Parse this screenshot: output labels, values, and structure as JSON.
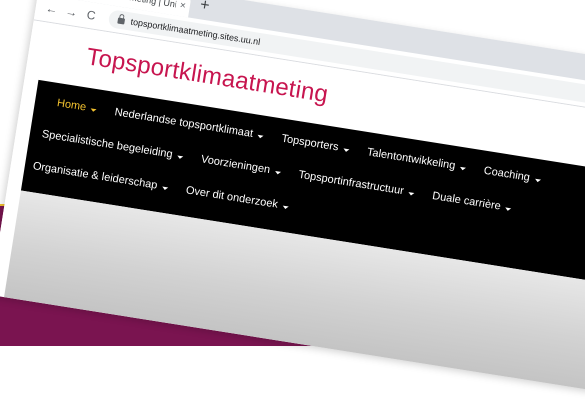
{
  "browser": {
    "tab_title": "Topsportklimaatmeting | Univers",
    "tab_close": "×",
    "new_tab": "+",
    "back": "←",
    "forward": "→",
    "reload": "C",
    "url": "topsportklimaatmeting.sites.uu.nl"
  },
  "site": {
    "title": "Topsportklimaatmeting",
    "nav_rows": [
      [
        "Home",
        "Nederlandse topsportklimaat",
        "Topsporters",
        "Talentontwikkeling",
        "Coaching"
      ],
      [
        "Specialistische begeleiding",
        "Voorzieningen",
        "Topsportinfrastructuur",
        "Duale carrière"
      ],
      [
        "Organisatie & leiderschap",
        "Over dit onderzoek"
      ]
    ]
  },
  "colors": {
    "title": "#c7154f",
    "navbar": "#000000",
    "active_nav": "#f2c12e",
    "backdrop": "#7a1450",
    "divider": "#f2c12e"
  },
  "icons": {
    "favicon": "uu-seal-icon",
    "lock": "lock-icon",
    "caret": "caret-down-icon"
  }
}
